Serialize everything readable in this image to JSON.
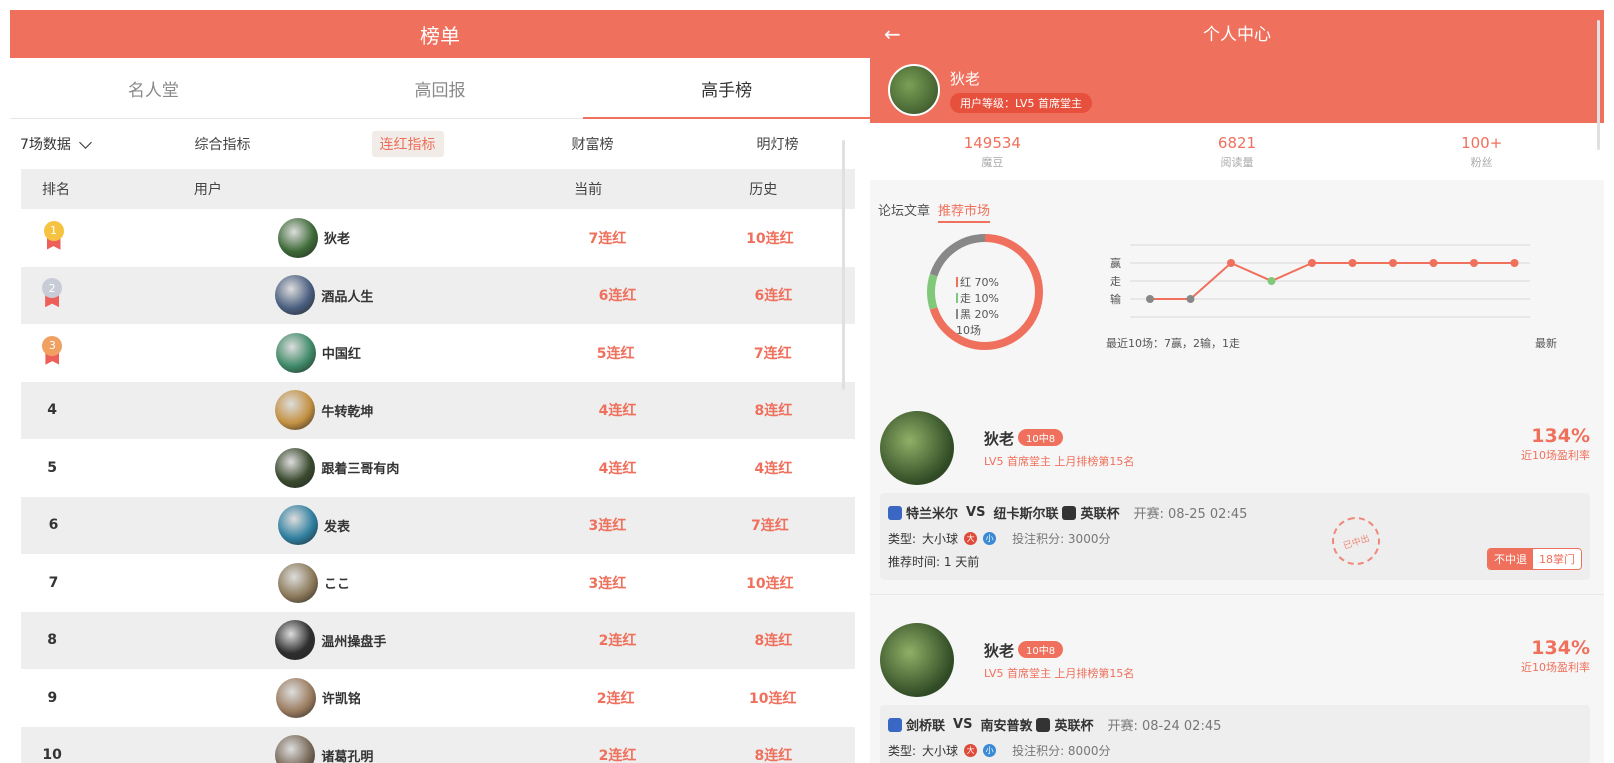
{
  "left": {
    "title": "榜单",
    "tabs": [
      "名人堂",
      "高回报",
      "高手榜"
    ],
    "active_tab": 2,
    "dropdown": "7场数据",
    "subitems": [
      "综合指标",
      "连红指标",
      "财富榜",
      "明灯榜"
    ],
    "active_subitem": 1,
    "headers": {
      "rank": "排名",
      "user": "用户",
      "current": "当前",
      "history": "历史"
    },
    "rows": [
      {
        "rank": "1",
        "name": "狄老",
        "current": "7连红",
        "history": "10连红",
        "avatar": "#3d6a37"
      },
      {
        "rank": "2",
        "name": "酒品人生",
        "current": "6连红",
        "history": "6连红",
        "avatar": "#4a5f80"
      },
      {
        "rank": "3",
        "name": "中国红",
        "current": "5连红",
        "history": "7连红",
        "avatar": "#3f8a68"
      },
      {
        "rank": "4",
        "name": "牛转乾坤",
        "current": "4连红",
        "history": "8连红",
        "avatar": "#c39142"
      },
      {
        "rank": "5",
        "name": "跟着三哥有肉",
        "current": "4连红",
        "history": "4连红",
        "avatar": "#3a4a2e"
      },
      {
        "rank": "6",
        "name": "发表",
        "current": "3连红",
        "history": "7连红",
        "avatar": "#2f7fa0"
      },
      {
        "rank": "7",
        "name": "ここ",
        "current": "3连红",
        "history": "10连红",
        "avatar": "#8c7a5a"
      },
      {
        "rank": "8",
        "name": "温州操盘手",
        "current": "2连红",
        "history": "8连红",
        "avatar": "#2e2e2e"
      },
      {
        "rank": "9",
        "name": "许凯铭",
        "current": "2连红",
        "history": "10连红",
        "avatar": "#9b7c60"
      },
      {
        "rank": "10",
        "name": "诸葛孔明",
        "current": "2连红",
        "history": "8连红",
        "avatar": "#7a6a5a"
      }
    ],
    "medal_colors": [
      "#f5c242",
      "#c8ccd6",
      "#f0a061"
    ]
  },
  "right": {
    "title": "个人中心",
    "profile_name": "狄老",
    "profile_level": "用户等级：LV5 首席堂主",
    "stats": [
      {
        "num": "149534",
        "label": "魔豆"
      },
      {
        "num": "6821",
        "label": "阅读量"
      },
      {
        "num": "100+",
        "label": "粉丝"
      }
    ],
    "feed_tabs": [
      "论坛文章",
      "推荐市场"
    ],
    "donut": {
      "red": "红 70%",
      "walk": "走 10%",
      "black": "黑 20%",
      "count": "10场"
    },
    "line_chart": {
      "y_labels": [
        "赢",
        "走",
        "输"
      ],
      "caption": "最近10场：7赢，2输，1走",
      "latest": "最新"
    },
    "posts": [
      {
        "name": "狄老",
        "badge": "10中8",
        "meta": "LV5 首席堂主   上月排榜第15名",
        "rate": "134%",
        "rate_label": "近10场盈利率",
        "home": "特兰米尔",
        "away": "纽卡斯尔联",
        "vs": "VS",
        "league": "英联杯",
        "kickoff": "开赛:   08-25 02:45",
        "type_label": "类型:",
        "type": "大小球",
        "points": "投注积分:   3000分",
        "time": "推荐时间:   1 天前",
        "stamp": "已中出",
        "chip_a": "不中退",
        "chip_b": "18掌门"
      },
      {
        "name": "狄老",
        "badge": "10中8",
        "meta": "LV5 首席堂主   上月排榜第15名",
        "rate": "134%",
        "rate_label": "近10场盈利率",
        "home": "剑桥联",
        "away": "南安普敦",
        "vs": "VS",
        "league": "英联杯",
        "kickoff": "开赛:   08-24 02:45",
        "type_label": "类型:",
        "type": "大小球",
        "points": "投注积分:   8000分"
      }
    ]
  },
  "colors": {
    "accent": "#ef705c",
    "win_green": "#82c87a",
    "gray": "#888888"
  },
  "chart_data": {
    "type": "line",
    "x": [
      1,
      2,
      3,
      4,
      5,
      6,
      7,
      8,
      9,
      10
    ],
    "series": [
      {
        "values": [
          "输",
          "输",
          "赢",
          "走",
          "赢",
          "赢",
          "赢",
          "赢",
          "赢",
          "赢"
        ]
      }
    ],
    "y_categories": [
      "输",
      "走",
      "赢"
    ],
    "xlabel": "最近10场：7赢，2输，1走",
    "ylabel": ""
  }
}
